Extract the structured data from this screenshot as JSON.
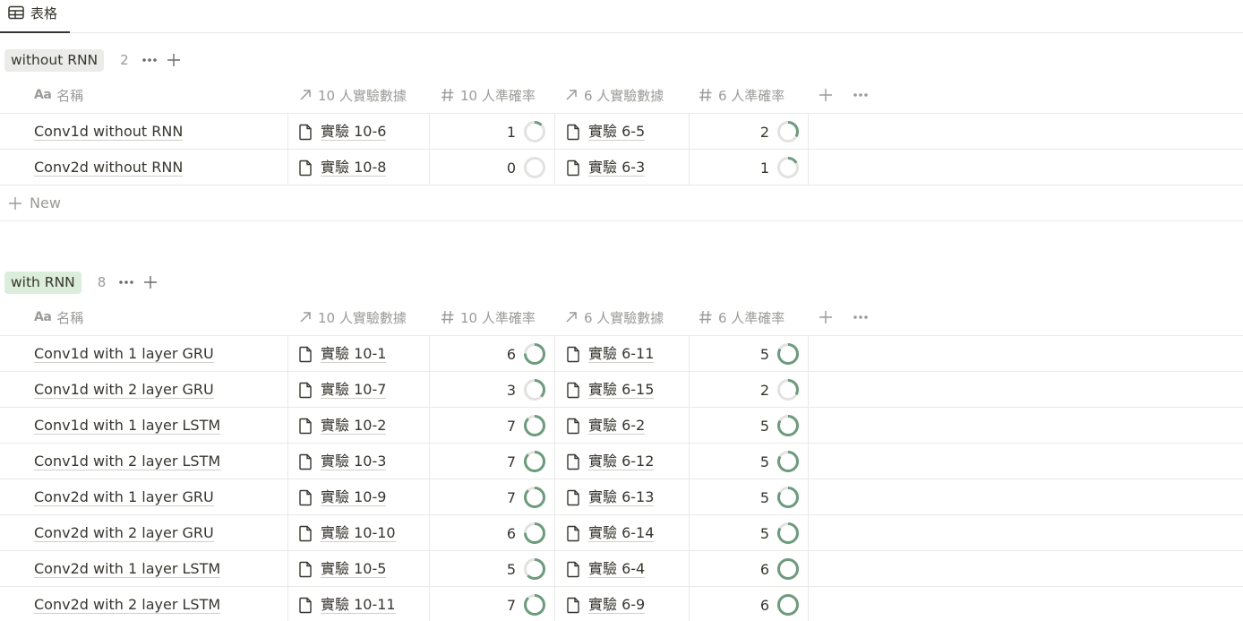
{
  "view_tab": {
    "label": "表格",
    "icon": "table-icon"
  },
  "columns": {
    "name": "名稱",
    "name_icon_text": "Aa",
    "rel10": "10 人實驗數據",
    "acc10": "10 人準確率",
    "rel6": "6 人實驗數據",
    "acc6": "6 人準確率"
  },
  "colors": {
    "ring_fill": "#6c9b7d",
    "ring_track": "#e3e2e0"
  },
  "new_label": "New",
  "groups": [
    {
      "name": "without RNN",
      "count": "2",
      "rows": [
        {
          "name": "Conv1d without RNN",
          "rel10": "實驗 10-6",
          "acc10": "1",
          "acc10_fraction": 0.125,
          "rel6": "實驗 6-5",
          "acc6": "2",
          "acc6_fraction": 0.333
        },
        {
          "name": "Conv2d without RNN",
          "rel10": "實驗 10-8",
          "acc10": "0",
          "acc10_fraction": 0.0,
          "rel6": "實驗 6-3",
          "acc6": "1",
          "acc6_fraction": 0.167
        }
      ]
    },
    {
      "name": "with RNN",
      "count": "8",
      "rows": [
        {
          "name": "Conv1d with 1 layer GRU",
          "rel10": "實驗 10-1",
          "acc10": "6",
          "acc10_fraction": 0.75,
          "rel6": "實驗 6-11",
          "acc6": "5",
          "acc6_fraction": 0.833
        },
        {
          "name": "Conv1d with 2 layer GRU",
          "rel10": "實驗 10-7",
          "acc10": "3",
          "acc10_fraction": 0.375,
          "rel6": "實驗 6-15",
          "acc6": "2",
          "acc6_fraction": 0.333
        },
        {
          "name": "Conv1d with 1 layer LSTM",
          "rel10": "實驗 10-2",
          "acc10": "7",
          "acc10_fraction": 0.875,
          "rel6": "實驗 6-2",
          "acc6": "5",
          "acc6_fraction": 0.833
        },
        {
          "name": "Conv1d with 2 layer LSTM",
          "rel10": "實驗 10-3",
          "acc10": "7",
          "acc10_fraction": 0.875,
          "rel6": "實驗 6-12",
          "acc6": "5",
          "acc6_fraction": 0.833
        },
        {
          "name": "Conv2d with 1 layer GRU",
          "rel10": "實驗 10-9",
          "acc10": "7",
          "acc10_fraction": 0.875,
          "rel6": "實驗 6-13",
          "acc6": "5",
          "acc6_fraction": 0.833
        },
        {
          "name": "Conv2d with 2 layer GRU",
          "rel10": "實驗 10-10",
          "acc10": "6",
          "acc10_fraction": 0.75,
          "rel6": "實驗 6-14",
          "acc6": "5",
          "acc6_fraction": 0.833
        },
        {
          "name": "Conv2d with 1 layer LSTM",
          "rel10": "實驗 10-5",
          "acc10": "5",
          "acc10_fraction": 0.625,
          "rel6": "實驗 6-4",
          "acc6": "6",
          "acc6_fraction": 1.0
        },
        {
          "name": "Conv2d with 2 layer LSTM",
          "rel10": "實驗 10-11",
          "acc10": "7",
          "acc10_fraction": 0.875,
          "rel6": "實驗 6-9",
          "acc6": "6",
          "acc6_fraction": 1.0
        }
      ]
    }
  ]
}
